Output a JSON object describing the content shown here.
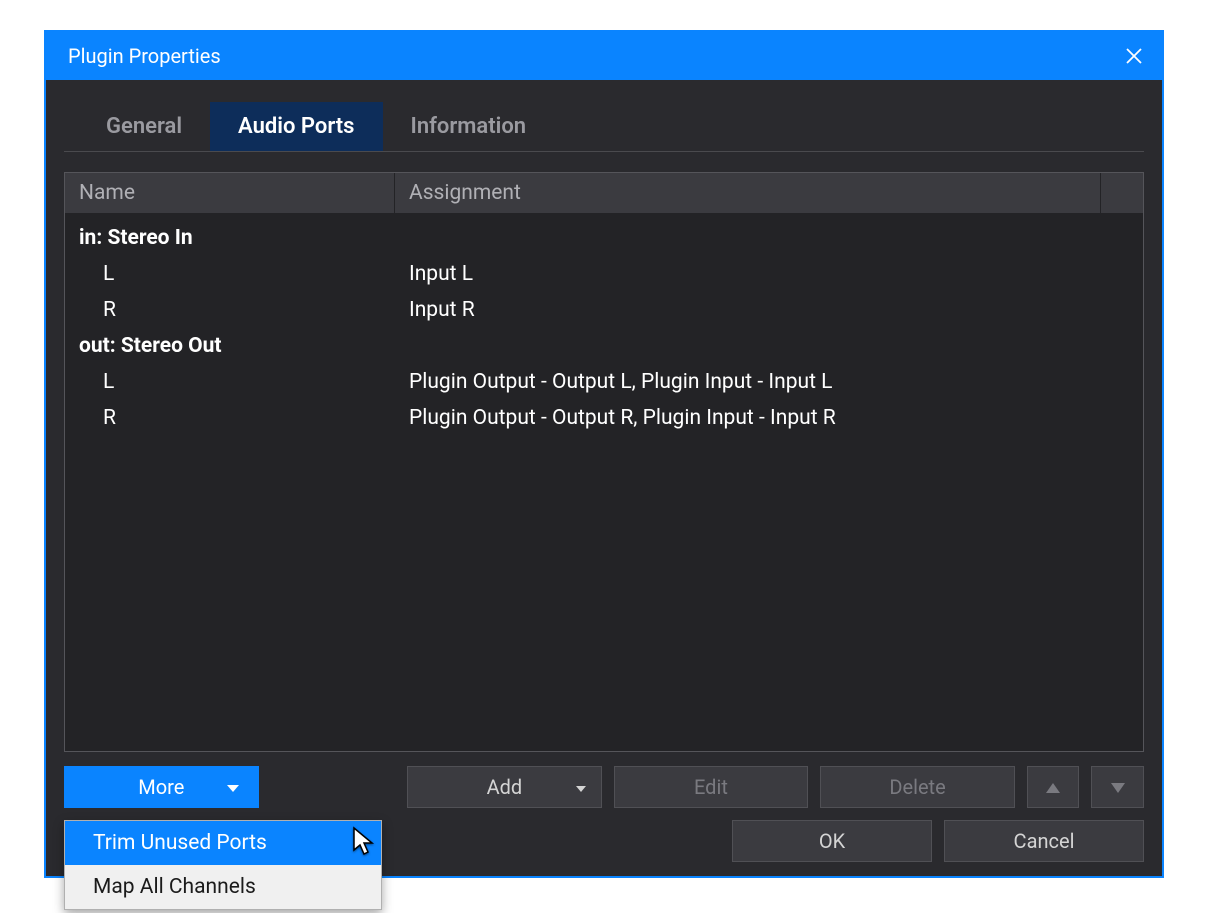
{
  "window": {
    "title": "Plugin Properties"
  },
  "tabs": [
    {
      "label": "General",
      "active": false
    },
    {
      "label": "Audio Ports",
      "active": true
    },
    {
      "label": "Information",
      "active": false
    }
  ],
  "table": {
    "headers": {
      "name": "Name",
      "assignment": "Assignment"
    },
    "rows": [
      {
        "type": "group",
        "name": "in: Stereo In",
        "assignment": ""
      },
      {
        "type": "child",
        "name": "L",
        "assignment": "Input L"
      },
      {
        "type": "child",
        "name": "R",
        "assignment": "Input R"
      },
      {
        "type": "group",
        "name": "out: Stereo Out",
        "assignment": ""
      },
      {
        "type": "child",
        "name": "L",
        "assignment": "Plugin Output - Output L, Plugin Input - Input L"
      },
      {
        "type": "child",
        "name": "R",
        "assignment": "Plugin Output - Output R, Plugin Input - Input R"
      }
    ]
  },
  "buttons": {
    "more": "More",
    "add": "Add",
    "edit": "Edit",
    "delete": "Delete",
    "ok": "OK",
    "cancel": "Cancel"
  },
  "more_menu": [
    {
      "label": "Trim Unused Ports",
      "hover": true
    },
    {
      "label": "Map All Channels",
      "hover": false
    }
  ],
  "colors": {
    "accent": "#0a84ff",
    "tab_active_bg": "#0d2d5a",
    "panel_bg": "#2a2a2e"
  }
}
